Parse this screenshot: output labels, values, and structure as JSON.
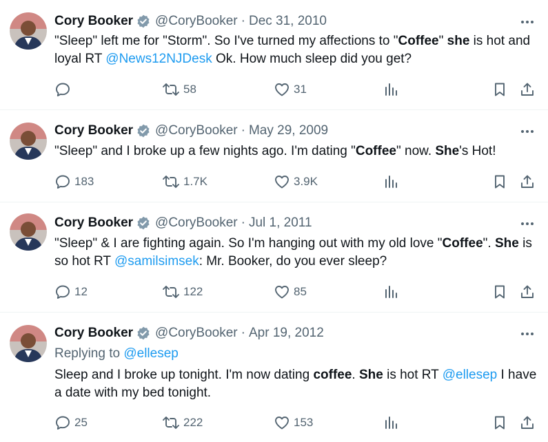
{
  "tweets": [
    {
      "name": "Cory Booker",
      "handle": "@CoryBooker",
      "separator": "·",
      "date": "Dec 31, 2010",
      "text_parts": [
        {
          "t": "\"Sleep\" left me for \"Storm\". So I've turned my affections to \"",
          "s": "plain"
        },
        {
          "t": "Coffee",
          "s": "bold"
        },
        {
          "t": "\" ",
          "s": "plain"
        },
        {
          "t": "she",
          "s": "bold"
        },
        {
          "t": " is hot and loyal RT ",
          "s": "plain"
        },
        {
          "t": "@News12NJDesk",
          "s": "mention"
        },
        {
          "t": " Ok. How much sleep did you get?",
          "s": "plain"
        }
      ],
      "replies": "",
      "retweets": "58",
      "likes": "31"
    },
    {
      "name": "Cory Booker",
      "handle": "@CoryBooker",
      "separator": "·",
      "date": "May 29, 2009",
      "text_parts": [
        {
          "t": "\"Sleep\" and I broke up a few nights ago. I'm dating \"",
          "s": "plain"
        },
        {
          "t": "Coffee",
          "s": "bold"
        },
        {
          "t": "\" now. ",
          "s": "plain"
        },
        {
          "t": "She",
          "s": "bold"
        },
        {
          "t": "'s Hot!",
          "s": "plain"
        }
      ],
      "replies": "183",
      "retweets": "1.7K",
      "likes": "3.9K"
    },
    {
      "name": "Cory Booker",
      "handle": "@CoryBooker",
      "separator": "·",
      "date": "Jul 1, 2011",
      "text_parts": [
        {
          "t": "\"Sleep\" & I are fighting again. So I'm hanging out with my old love \"",
          "s": "plain"
        },
        {
          "t": "Coffee",
          "s": "bold"
        },
        {
          "t": "\". ",
          "s": "plain"
        },
        {
          "t": "She",
          "s": "bold"
        },
        {
          "t": " is so hot RT ",
          "s": "plain"
        },
        {
          "t": "@samilsimsek",
          "s": "mention"
        },
        {
          "t": ": Mr. Booker, do you ever sleep?",
          "s": "plain"
        }
      ],
      "replies": "12",
      "retweets": "122",
      "likes": "85"
    },
    {
      "name": "Cory Booker",
      "handle": "@CoryBooker",
      "separator": "·",
      "date": "Apr 19, 2012",
      "replying_label": "Replying to ",
      "replying_handle": "@ellesep",
      "text_parts": [
        {
          "t": "Sleep and I broke up tonight. I'm now dating ",
          "s": "plain"
        },
        {
          "t": "coffee",
          "s": "bold"
        },
        {
          "t": ".  ",
          "s": "plain"
        },
        {
          "t": "She",
          "s": "bold"
        },
        {
          "t": " is hot RT ",
          "s": "plain"
        },
        {
          "t": "@ellesep",
          "s": "mention"
        },
        {
          "t": " I have a date with my bed tonight.",
          "s": "plain"
        }
      ],
      "replies": "25",
      "retweets": "222",
      "likes": "153"
    }
  ],
  "icons": {
    "verified": "verified-badge-icon",
    "more": "more-icon",
    "reply": "reply-icon",
    "retweet": "retweet-icon",
    "like": "like-icon",
    "views": "views-icon",
    "bookmark": "bookmark-icon",
    "share": "share-icon"
  },
  "colors": {
    "text": "#0f1419",
    "secondary": "#536471",
    "link": "#1d9bf0",
    "verified": "#829aab",
    "divider": "#eff3f4"
  }
}
